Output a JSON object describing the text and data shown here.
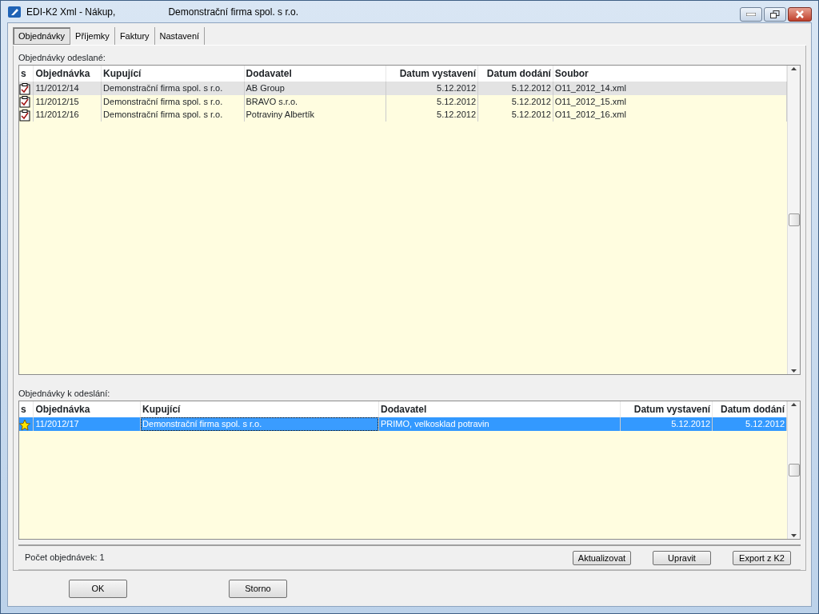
{
  "window": {
    "title": "EDI-K2 Xml - Nákup,",
    "company": "Demonstrační firma spol. s r.o."
  },
  "tabs": [
    {
      "label": "Objednávky",
      "selected": true
    },
    {
      "label": "Příjemky",
      "selected": false
    },
    {
      "label": "Faktury",
      "selected": false
    },
    {
      "label": "Nastavení",
      "selected": false
    }
  ],
  "sent_orders": {
    "label": "Objednávky odeslané:",
    "columns": [
      "s",
      "Objednávka",
      "Kupující",
      "Dodavatel",
      "Datum vystavení",
      "Datum dodání",
      "Soubor"
    ],
    "rows": [
      {
        "kind": "sent",
        "selected": true,
        "cells": [
          "",
          "11/2012/14",
          "Demonstrační firma spol. s r.o.",
          "AB Group",
          "5.12.2012",
          "5.12.2012",
          "O11_2012_14.xml"
        ]
      },
      {
        "kind": "sent",
        "selected": false,
        "cells": [
          "",
          "11/2012/15",
          "Demonstrační firma spol. s r.o.",
          "BRAVO s.r.o.",
          "5.12.2012",
          "5.12.2012",
          "O11_2012_15.xml"
        ]
      },
      {
        "kind": "sent",
        "selected": false,
        "cells": [
          "",
          "11/2012/16",
          "Demonstrační firma spol. s r.o.",
          "Potraviny Albertík",
          "5.12.2012",
          "5.12.2012",
          "O11_2012_16.xml"
        ]
      }
    ]
  },
  "pending_orders": {
    "label": "Objednávky k odeslání:",
    "columns": [
      "s",
      "Objednávka",
      "Kupující",
      "Dodavatel",
      "Datum vystavení",
      "Datum dodání"
    ],
    "rows": [
      {
        "kind": "new",
        "selected": true,
        "cells": [
          "",
          "11/2012/17",
          "Demonstrační firma spol. s r.o.",
          "PRIMO, velkosklad potravin",
          "5.12.2012",
          "5.12.2012"
        ]
      }
    ]
  },
  "footer": {
    "count": "Počet objednávek: 1",
    "buttons": [
      "Aktualizovat",
      "Upravit",
      "Export z K2"
    ]
  },
  "dialog_buttons": [
    "OK",
    "Storno"
  ]
}
